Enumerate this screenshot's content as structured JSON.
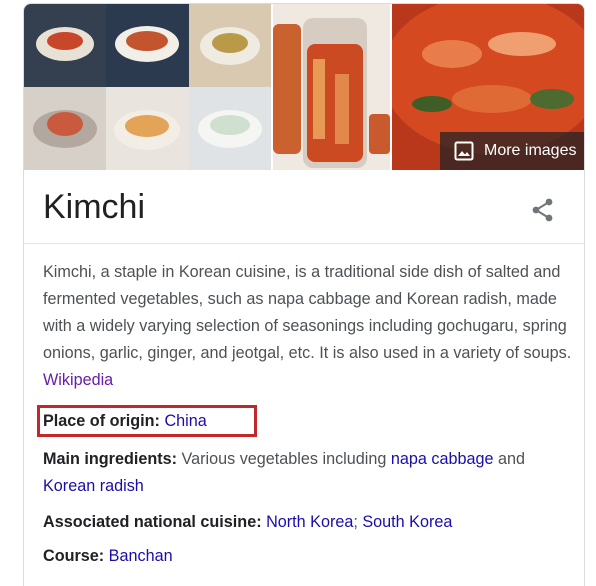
{
  "title": "Kimchi",
  "more_images_label": "More images",
  "description": {
    "text": "Kimchi, a staple in Korean cuisine, is a traditional side dish of salted and fermented vegetables, such as napa cabbage and Korean radish, made with a widely varying selection of seasonings including gochugaru, spring onions, garlic, ginger, and jeotgal, etc. It is also used in a variety of soups.",
    "source_link": "Wikipedia"
  },
  "facts": {
    "origin": {
      "label": "Place of origin:",
      "value": "China"
    },
    "ingredients": {
      "label": "Main ingredients:",
      "text_before": "Various vegetables including",
      "link1": "napa cabbage",
      "between": "and",
      "link2": "Korean radish"
    },
    "cuisine": {
      "label": "Associated national cuisine:",
      "link1": "North Korea",
      "separator": ";",
      "link2": "South Korea"
    },
    "course": {
      "label": "Course:",
      "value": "Banchan"
    }
  },
  "icons": {
    "images": "image-icon",
    "share": "share-icon"
  },
  "colors": {
    "link": "#1a0dab",
    "visited_link": "#681da8",
    "highlight_border": "#c0282a"
  }
}
